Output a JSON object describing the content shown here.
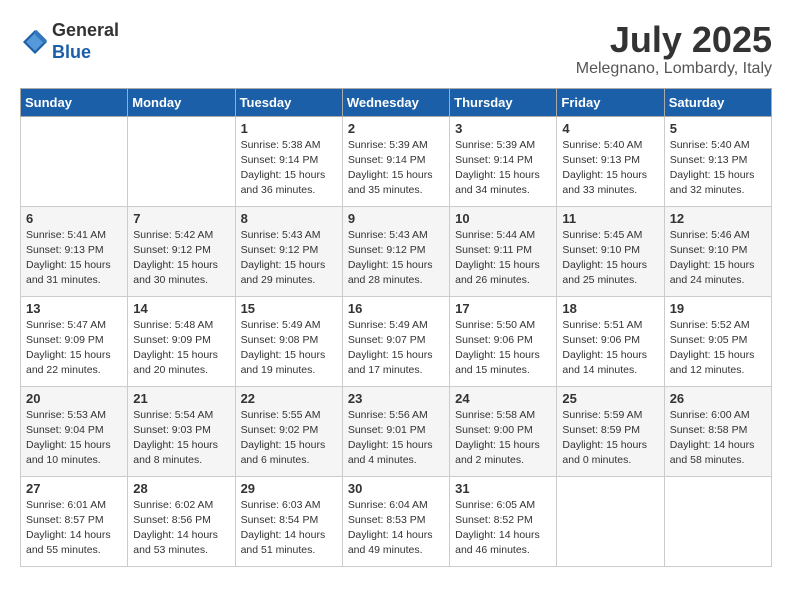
{
  "header": {
    "logo_line1": "General",
    "logo_line2": "Blue",
    "month": "July 2025",
    "location": "Melegnano, Lombardy, Italy"
  },
  "days_of_week": [
    "Sunday",
    "Monday",
    "Tuesday",
    "Wednesday",
    "Thursday",
    "Friday",
    "Saturday"
  ],
  "weeks": [
    [
      {
        "num": "",
        "info": ""
      },
      {
        "num": "",
        "info": ""
      },
      {
        "num": "1",
        "info": "Sunrise: 5:38 AM\nSunset: 9:14 PM\nDaylight: 15 hours\nand 36 minutes."
      },
      {
        "num": "2",
        "info": "Sunrise: 5:39 AM\nSunset: 9:14 PM\nDaylight: 15 hours\nand 35 minutes."
      },
      {
        "num": "3",
        "info": "Sunrise: 5:39 AM\nSunset: 9:14 PM\nDaylight: 15 hours\nand 34 minutes."
      },
      {
        "num": "4",
        "info": "Sunrise: 5:40 AM\nSunset: 9:13 PM\nDaylight: 15 hours\nand 33 minutes."
      },
      {
        "num": "5",
        "info": "Sunrise: 5:40 AM\nSunset: 9:13 PM\nDaylight: 15 hours\nand 32 minutes."
      }
    ],
    [
      {
        "num": "6",
        "info": "Sunrise: 5:41 AM\nSunset: 9:13 PM\nDaylight: 15 hours\nand 31 minutes."
      },
      {
        "num": "7",
        "info": "Sunrise: 5:42 AM\nSunset: 9:12 PM\nDaylight: 15 hours\nand 30 minutes."
      },
      {
        "num": "8",
        "info": "Sunrise: 5:43 AM\nSunset: 9:12 PM\nDaylight: 15 hours\nand 29 minutes."
      },
      {
        "num": "9",
        "info": "Sunrise: 5:43 AM\nSunset: 9:12 PM\nDaylight: 15 hours\nand 28 minutes."
      },
      {
        "num": "10",
        "info": "Sunrise: 5:44 AM\nSunset: 9:11 PM\nDaylight: 15 hours\nand 26 minutes."
      },
      {
        "num": "11",
        "info": "Sunrise: 5:45 AM\nSunset: 9:10 PM\nDaylight: 15 hours\nand 25 minutes."
      },
      {
        "num": "12",
        "info": "Sunrise: 5:46 AM\nSunset: 9:10 PM\nDaylight: 15 hours\nand 24 minutes."
      }
    ],
    [
      {
        "num": "13",
        "info": "Sunrise: 5:47 AM\nSunset: 9:09 PM\nDaylight: 15 hours\nand 22 minutes."
      },
      {
        "num": "14",
        "info": "Sunrise: 5:48 AM\nSunset: 9:09 PM\nDaylight: 15 hours\nand 20 minutes."
      },
      {
        "num": "15",
        "info": "Sunrise: 5:49 AM\nSunset: 9:08 PM\nDaylight: 15 hours\nand 19 minutes."
      },
      {
        "num": "16",
        "info": "Sunrise: 5:49 AM\nSunset: 9:07 PM\nDaylight: 15 hours\nand 17 minutes."
      },
      {
        "num": "17",
        "info": "Sunrise: 5:50 AM\nSunset: 9:06 PM\nDaylight: 15 hours\nand 15 minutes."
      },
      {
        "num": "18",
        "info": "Sunrise: 5:51 AM\nSunset: 9:06 PM\nDaylight: 15 hours\nand 14 minutes."
      },
      {
        "num": "19",
        "info": "Sunrise: 5:52 AM\nSunset: 9:05 PM\nDaylight: 15 hours\nand 12 minutes."
      }
    ],
    [
      {
        "num": "20",
        "info": "Sunrise: 5:53 AM\nSunset: 9:04 PM\nDaylight: 15 hours\nand 10 minutes."
      },
      {
        "num": "21",
        "info": "Sunrise: 5:54 AM\nSunset: 9:03 PM\nDaylight: 15 hours\nand 8 minutes."
      },
      {
        "num": "22",
        "info": "Sunrise: 5:55 AM\nSunset: 9:02 PM\nDaylight: 15 hours\nand 6 minutes."
      },
      {
        "num": "23",
        "info": "Sunrise: 5:56 AM\nSunset: 9:01 PM\nDaylight: 15 hours\nand 4 minutes."
      },
      {
        "num": "24",
        "info": "Sunrise: 5:58 AM\nSunset: 9:00 PM\nDaylight: 15 hours\nand 2 minutes."
      },
      {
        "num": "25",
        "info": "Sunrise: 5:59 AM\nSunset: 8:59 PM\nDaylight: 15 hours\nand 0 minutes."
      },
      {
        "num": "26",
        "info": "Sunrise: 6:00 AM\nSunset: 8:58 PM\nDaylight: 14 hours\nand 58 minutes."
      }
    ],
    [
      {
        "num": "27",
        "info": "Sunrise: 6:01 AM\nSunset: 8:57 PM\nDaylight: 14 hours\nand 55 minutes."
      },
      {
        "num": "28",
        "info": "Sunrise: 6:02 AM\nSunset: 8:56 PM\nDaylight: 14 hours\nand 53 minutes."
      },
      {
        "num": "29",
        "info": "Sunrise: 6:03 AM\nSunset: 8:54 PM\nDaylight: 14 hours\nand 51 minutes."
      },
      {
        "num": "30",
        "info": "Sunrise: 6:04 AM\nSunset: 8:53 PM\nDaylight: 14 hours\nand 49 minutes."
      },
      {
        "num": "31",
        "info": "Sunrise: 6:05 AM\nSunset: 8:52 PM\nDaylight: 14 hours\nand 46 minutes."
      },
      {
        "num": "",
        "info": ""
      },
      {
        "num": "",
        "info": ""
      }
    ]
  ]
}
